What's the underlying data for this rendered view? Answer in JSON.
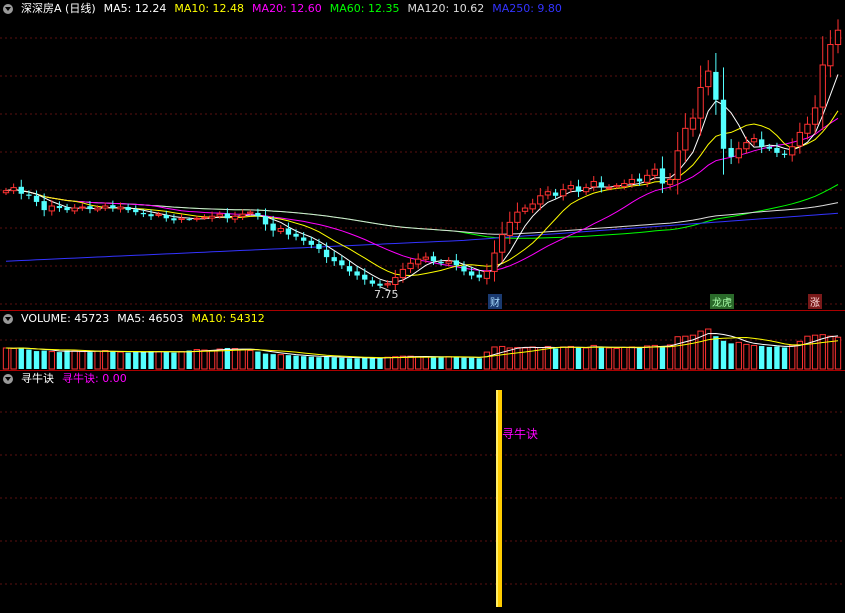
{
  "price_legend": {
    "title": "深深房A (日线)",
    "items": [
      {
        "label": "MA5: 12.24",
        "color": "#ffffff"
      },
      {
        "label": "MA10: 12.48",
        "color": "#ffff00"
      },
      {
        "label": "MA20: 12.60",
        "color": "#ff00ff"
      },
      {
        "label": "MA60: 12.35",
        "color": "#00ff00"
      },
      {
        "label": "MA120: 10.62",
        "color": "#dddddd"
      },
      {
        "label": "MA250: 9.80",
        "color": "#3333ff"
      }
    ]
  },
  "price_low_label": "7.75",
  "event_tags": [
    {
      "text": "财",
      "color": "#aaddff",
      "bg": "#1a3a70"
    },
    {
      "text": "龙虎",
      "color": "#aaffaa",
      "bg": "#2a6a2a"
    },
    {
      "text": "涨",
      "color": "#ffdddd",
      "bg": "#7a1a1a"
    }
  ],
  "volume_legend": {
    "title": "VOLUME: 45723",
    "items": [
      {
        "label": "MA5: 46503",
        "color": "#ffffff"
      },
      {
        "label": "MA10: 54312",
        "color": "#ffff00"
      }
    ]
  },
  "indicator_legend": {
    "title": "寻牛诀",
    "items": [
      {
        "label": "寻牛诀: 0.00",
        "color": "#ff00ff"
      }
    ]
  },
  "indicator_signal_label": "寻牛诀",
  "chart_data": {
    "type": "candlestick",
    "closes": [
      12.45,
      12.6,
      12.3,
      12.2,
      11.9,
      11.5,
      11.7,
      11.6,
      11.5,
      11.6,
      11.65,
      11.55,
      11.6,
      11.7,
      11.6,
      11.65,
      11.5,
      11.4,
      11.3,
      11.2,
      11.3,
      11.1,
      11.0,
      11.1,
      11.05,
      11.1,
      11.15,
      11.2,
      11.3,
      11.1,
      11.2,
      11.3,
      11.4,
      11.2,
      10.8,
      10.5,
      10.6,
      10.3,
      10.2,
      10.0,
      9.8,
      9.6,
      9.2,
      9.0,
      8.8,
      8.5,
      8.3,
      8.1,
      7.9,
      7.8,
      7.9,
      8.2,
      8.6,
      8.9,
      9.1,
      9.2,
      9.0,
      8.9,
      9.0,
      8.8,
      8.5,
      8.3,
      8.2,
      8.5,
      9.4,
      10.3,
      10.9,
      11.4,
      11.6,
      11.8,
      12.2,
      12.4,
      12.2,
      12.5,
      12.7,
      12.4,
      12.6,
      12.9,
      12.6,
      12.6,
      12.7,
      12.8,
      13.0,
      12.9,
      13.2,
      13.5,
      12.8,
      13.0,
      14.4,
      15.5,
      16.0,
      17.5,
      18.3,
      16.9,
      14.5,
      14.1,
      14.5,
      14.8,
      15.0,
      14.6,
      14.5,
      14.3,
      14.2,
      14.6,
      15.3,
      15.7,
      16.5,
      18.6,
      19.6,
      20.3
    ],
    "volume": [
      41000,
      40000,
      42000,
      38000,
      35000,
      36000,
      34000,
      33000,
      36000,
      35000,
      34000,
      33000,
      35000,
      36000,
      34000,
      33000,
      32000,
      33000,
      34000,
      35000,
      34000,
      33000,
      32000,
      34000,
      36000,
      38000,
      37000,
      36000,
      39000,
      41000,
      40000,
      38000,
      36000,
      34000,
      30000,
      29000,
      28000,
      27000,
      26000,
      25000,
      24000,
      23000,
      24000,
      23000,
      22000,
      21000,
      21000,
      22000,
      21000,
      22000,
      23000,
      24000,
      25000,
      25000,
      24000,
      24000,
      23000,
      23000,
      24000,
      23000,
      22000,
      22000,
      21000,
      33000,
      43000,
      44000,
      41000,
      42000,
      41000,
      43000,
      42000,
      44000,
      40000,
      43000,
      44000,
      42000,
      41000,
      46000,
      43000,
      41000,
      40000,
      42000,
      43000,
      42000,
      45000,
      46000,
      44000,
      47000,
      63000,
      64000,
      66000,
      74000,
      78000,
      64000,
      55000,
      50000,
      52000,
      48000,
      46000,
      45000,
      43000,
      44000,
      42000,
      46000,
      54000,
      64000,
      66000,
      67000,
      64000,
      62000
    ],
    "moving_averages": [
      "MA5",
      "MA10",
      "MA20",
      "MA60",
      "MA120",
      "MA250"
    ],
    "price_low": 7.75,
    "indicator": {
      "name": "寻牛诀",
      "value": 0.0
    }
  }
}
